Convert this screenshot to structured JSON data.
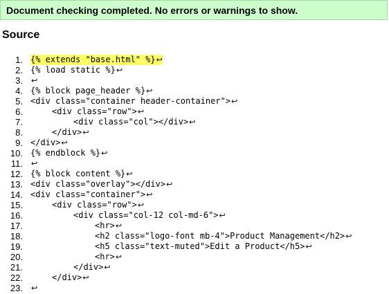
{
  "status": {
    "message": "Document checking completed. No errors or warnings to show."
  },
  "source": {
    "heading": "Source",
    "eol_symbol": "↩",
    "lines": [
      {
        "number": "1.",
        "indent": 0,
        "code": "{% extends \"base.html\" %}",
        "highlight": true
      },
      {
        "number": "2.",
        "indent": 0,
        "code": "{% load static %}",
        "highlight": false
      },
      {
        "number": "3.",
        "indent": 0,
        "code": "",
        "highlight": false
      },
      {
        "number": "4.",
        "indent": 0,
        "code": "{% block page_header %}",
        "highlight": false
      },
      {
        "number": "5.",
        "indent": 0,
        "code": "<div class=\"container header-container\">",
        "highlight": false
      },
      {
        "number": "6.",
        "indent": 1,
        "code": "<div class=\"row\">",
        "highlight": false
      },
      {
        "number": "7.",
        "indent": 2,
        "code": "<div class=\"col\"></div>",
        "highlight": false
      },
      {
        "number": "8.",
        "indent": 1,
        "code": "</div>",
        "highlight": false
      },
      {
        "number": "9.",
        "indent": 0,
        "code": "</div>",
        "highlight": false
      },
      {
        "number": "10.",
        "indent": 0,
        "code": "{% endblock %}",
        "highlight": false
      },
      {
        "number": "11.",
        "indent": 0,
        "code": "",
        "highlight": false
      },
      {
        "number": "12.",
        "indent": 0,
        "code": "{% block content %}",
        "highlight": false
      },
      {
        "number": "13.",
        "indent": 0,
        "code": "<div class=\"overlay\"></div>",
        "highlight": false
      },
      {
        "number": "14.",
        "indent": 0,
        "code": "<div class=\"container\">",
        "highlight": false
      },
      {
        "number": "15.",
        "indent": 1,
        "code": "<div class=\"row\">",
        "highlight": false
      },
      {
        "number": "16.",
        "indent": 2,
        "code": "<div class=\"col-12 col-md-6\">",
        "highlight": false
      },
      {
        "number": "17.",
        "indent": 3,
        "code": "<hr>",
        "highlight": false
      },
      {
        "number": "18.",
        "indent": 3,
        "code": "<h2 class=\"logo-font mb-4\">Product Management</h2>",
        "highlight": false
      },
      {
        "number": "19.",
        "indent": 3,
        "code": "<h5 class=\"text-muted\">Edit a Product</h5>",
        "highlight": false
      },
      {
        "number": "20.",
        "indent": 3,
        "code": "<hr>",
        "highlight": false
      },
      {
        "number": "21.",
        "indent": 2,
        "code": "</div>",
        "highlight": false
      },
      {
        "number": "22.",
        "indent": 1,
        "code": "</div>",
        "highlight": false
      },
      {
        "number": "23.",
        "indent": 0,
        "code": "",
        "highlight": false
      }
    ]
  }
}
